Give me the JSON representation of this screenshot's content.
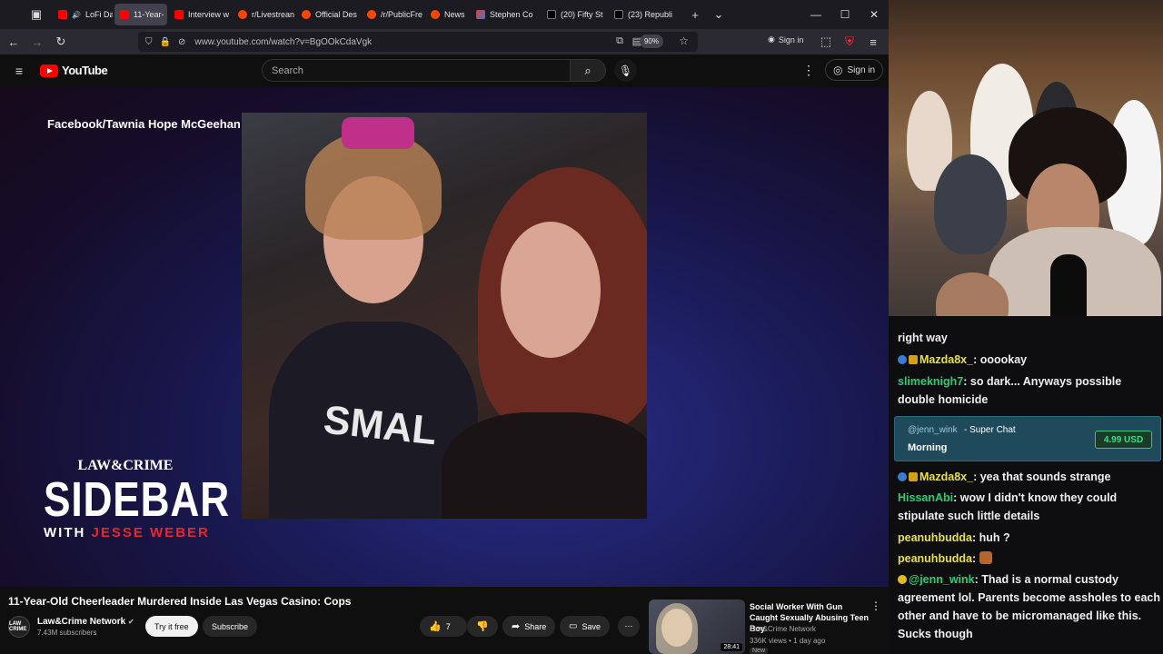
{
  "tabs": [
    {
      "label": "LoFi Da",
      "favicon": "youtube-icon",
      "audio": true
    },
    {
      "label": "11-Year-",
      "favicon": "youtube-icon",
      "active": true
    },
    {
      "label": "Interview w",
      "favicon": "youtube-icon"
    },
    {
      "label": "r/Livestrean",
      "favicon": "reddit-icon"
    },
    {
      "label": "Official Des",
      "favicon": "reddit-icon"
    },
    {
      "label": "/r/PublicFre",
      "favicon": "reddit-icon"
    },
    {
      "label": "News",
      "favicon": "reddit-icon"
    },
    {
      "label": "Stephen Co",
      "favicon": "stephen-icon"
    },
    {
      "label": "(20) Fifty St",
      "favicon": "x-icon"
    },
    {
      "label": "(23) Republi",
      "favicon": "x-icon"
    }
  ],
  "browser": {
    "url": "www.youtube.com/watch?v=BgOOkCdaVgk",
    "zoom": "90%",
    "signin": "Sign in"
  },
  "youtube": {
    "logo_text": "YouTube",
    "search_placeholder": "Search",
    "signin": "Sign in"
  },
  "video": {
    "credit": "Facebook/Tawnia Hope McGeehan",
    "brand_top": "LAW&CRIME",
    "brand_main": "SIDEBAR",
    "brand_with": "WITH",
    "brand_host": "JESSE WEBER",
    "title": "11-Year-Old Cheerleader Murdered Inside Las Vegas Casino: Cops",
    "channel": "Law&Crime Network",
    "channel_avatar": "LAW CRIME",
    "subscribers": "7.43M subscribers",
    "try_free": "Try it free",
    "subscribe": "Subscribe",
    "likes": "7",
    "share": "Share",
    "save": "Save"
  },
  "recommendation": {
    "title": "Social Worker With Gun Caught Sexually Abusing Teen Boy",
    "channel": "Law&Crime Network",
    "meta": "336K views • 1 day ago",
    "badge": "New",
    "duration": "28:41"
  },
  "chat": {
    "messages": [
      {
        "user": "",
        "text": "right way",
        "color": "#efeff1"
      },
      {
        "user": "Mazda8x_",
        "text": ": ooookay",
        "color": "#e8e04a",
        "badges": true
      },
      {
        "user": "slimeknigh7",
        "text": ": so dark... Anyways possible double homicide",
        "color": "#2ecc71"
      },
      {
        "user": "Mazda8x_",
        "text": ": yea that sounds strange",
        "color": "#e8e04a",
        "badges": true
      },
      {
        "user": "HissanAbi",
        "text": ": wow I didn't know they could stipulate such little details",
        "color": "#2ecc71"
      },
      {
        "user": "peanuhbudda",
        "text": ": huh ?",
        "color": "#e8e04a"
      },
      {
        "user": "peanuhbudda",
        "text": ": ",
        "color": "#e8e04a"
      },
      {
        "user": "@jenn_wink",
        "text": ": Thad is a normal custody agreement lol. Parents become assholes to each other and have to be micromanaged like this. Sucks though",
        "color": "#2ecc71",
        "badges": true
      }
    ],
    "superchat": {
      "user": "@jenn_wink",
      "label": "- Super Chat",
      "message": "Morning",
      "amount": "4.99 USD"
    }
  },
  "colors": {
    "youtube_red": "#ff0000",
    "superchat_bg": "#1f4a5c",
    "superchat_amount": "#3ddc84",
    "host_red": "#e8262b"
  }
}
